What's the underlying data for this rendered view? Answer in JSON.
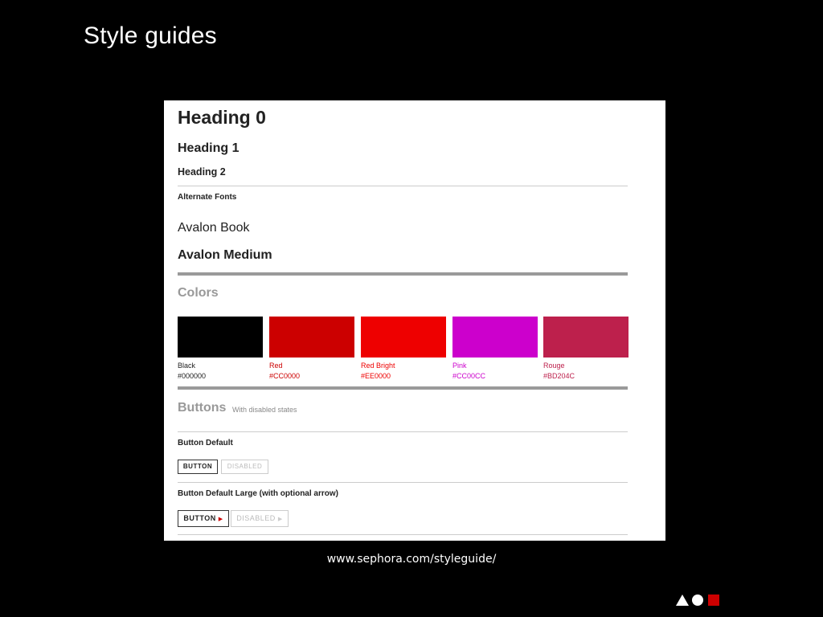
{
  "slide": {
    "title": "Style guides",
    "url": "www.sephora.com/styleguide/"
  },
  "guide": {
    "heading0": "Heading 0",
    "heading1": "Heading 1",
    "heading2": "Heading 2",
    "alternate_fonts_label": "Alternate Fonts",
    "font_book": "Avalon Book",
    "font_medium": "Avalon Medium",
    "colors_title": "Colors",
    "swatches": [
      {
        "name": "Black",
        "hex": "#000000",
        "color": "#000000",
        "text_color": "#222222"
      },
      {
        "name": "Red",
        "hex": "#CC0000",
        "color": "#CC0000",
        "text_color": "#CC0000"
      },
      {
        "name": "Red Bright",
        "hex": "#EE0000",
        "color": "#EE0000",
        "text_color": "#EE0000"
      },
      {
        "name": "Pink",
        "hex": "#CC00CC",
        "color": "#CC00CC",
        "text_color": "#CC00CC"
      },
      {
        "name": "Rouge",
        "hex": "#BD204C",
        "color": "#BD204C",
        "text_color": "#BD204C"
      }
    ],
    "buttons_title": "Buttons",
    "buttons_subtitle": "With disabled states",
    "button_default_label": "Button Default",
    "button_default_large_label": "Button Default Large (with optional arrow)",
    "button_text": "BUTTON",
    "disabled_text": "DISABLED"
  },
  "logo": {
    "icons": [
      "triangle-icon",
      "circle-icon",
      "square-icon"
    ],
    "colors": {
      "triangle": "#ffffff",
      "circle": "#ffffff",
      "square": "#CC0000"
    }
  }
}
